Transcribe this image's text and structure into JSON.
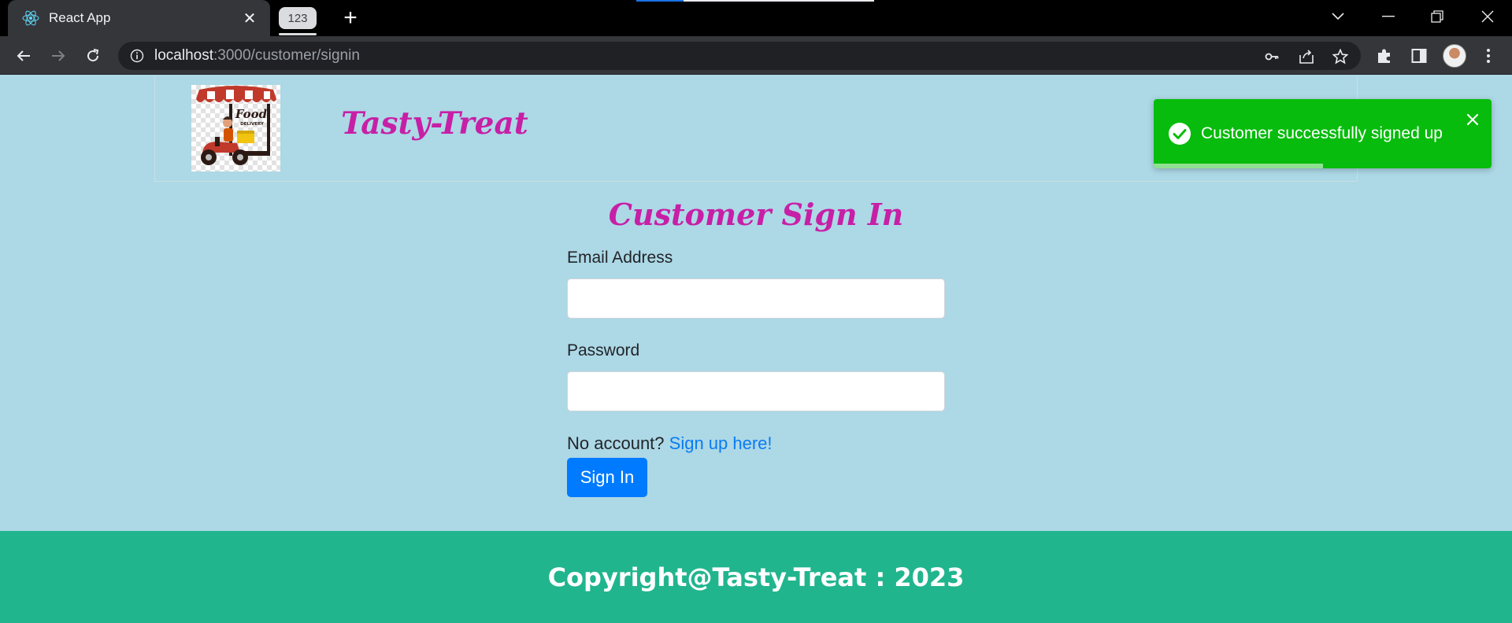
{
  "browser": {
    "tabs": [
      {
        "title": "React App",
        "icon": "react-icon"
      },
      {
        "title": "123"
      }
    ],
    "url_host": "localhost",
    "url_path": ":3000/customer/signin",
    "colors": {
      "chrome_dark": "#35363a",
      "omnibox": "#202124"
    }
  },
  "header": {
    "brand": "Tasty-Treat",
    "logo_text": "Food",
    "logo_subtext": "DELIVERY"
  },
  "toast": {
    "message": "Customer successfully signed up",
    "progress": 0.5,
    "color": "#07bc0c"
  },
  "form": {
    "title": "Customer Sign In",
    "email_label": "Email Address",
    "email_value": "",
    "password_label": "Password",
    "password_value": "",
    "no_account_text": "No account?",
    "signup_link": "Sign up here!",
    "submit_label": "Sign In"
  },
  "footer": {
    "text": "Copyright@Tasty-Treat : 2023",
    "color": "#21b58e"
  },
  "colors": {
    "page_bg": "#add8e6",
    "brand": "#c71fa6",
    "primary": "#007bff"
  }
}
